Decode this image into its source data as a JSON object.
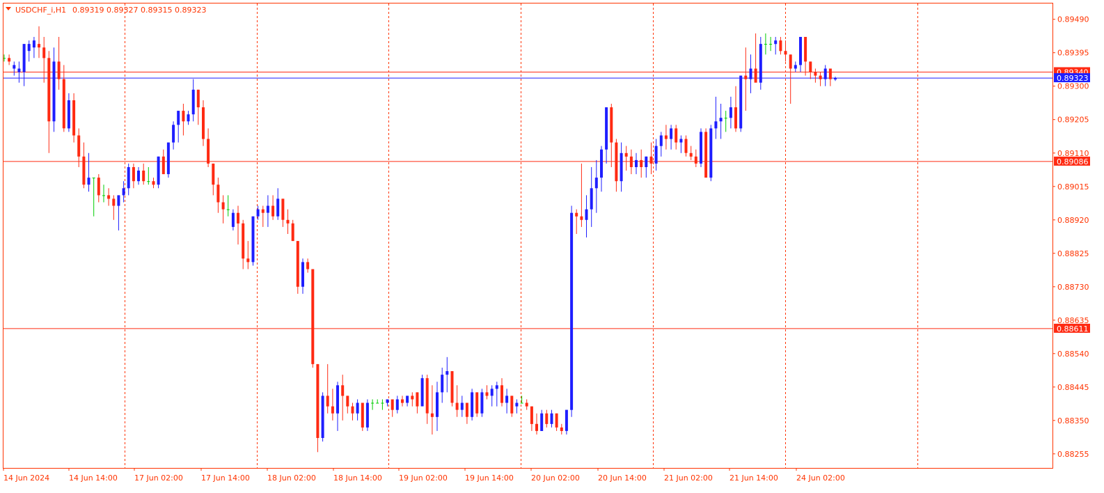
{
  "header": {
    "symbol": "USDCHF_i,H1",
    "ohlc": "0.89319 0.89327 0.89315 0.89323"
  },
  "colors": {
    "bull": "#1e1eff",
    "bear": "#ff2a12",
    "doji": "#00cc00",
    "grid": "#ff3300",
    "text": "#ff3300",
    "level": "#ff2a12",
    "bid_line": "#1e1eff",
    "frame": "#ff3300"
  },
  "chart_data": {
    "type": "candlestick",
    "symbol": "USDCHF_i",
    "timeframe": "H1",
    "ylim": [
      0.88215,
      0.89535
    ],
    "y_ticks": [
      "0.89490",
      "0.89395",
      "0.89300",
      "0.89205",
      "0.89110",
      "0.89015",
      "0.88920",
      "0.88825",
      "0.88730",
      "0.88635",
      "0.88540",
      "0.88445",
      "0.88350",
      "0.88255"
    ],
    "x_labels": [
      "14 Jun 2024",
      "14 Jun 14:00",
      "17 Jun 02:00",
      "17 Jun 14:00",
      "18 Jun 02:00",
      "18 Jun 14:00",
      "19 Jun 02:00",
      "19 Jun 14:00",
      "20 Jun 02:00",
      "20 Jun 14:00",
      "21 Jun 02:00",
      "21 Jun 14:00",
      "24 Jun 02:00"
    ],
    "grid": "vertical dotted",
    "price_levels": [
      {
        "label": "0.89340",
        "value": 0.8934,
        "role": "horizontal line"
      },
      {
        "label": "0.89323",
        "value": 0.89323,
        "role": "bid line"
      },
      {
        "label": "0.89086",
        "value": 0.89086,
        "role": "horizontal line"
      },
      {
        "label": "0.88611",
        "value": 0.88611,
        "role": "horizontal line"
      }
    ],
    "candles": [
      [
        0.8938,
        0.8939,
        0.8937,
        0.8938
      ],
      [
        0.8938,
        0.8939,
        0.8936,
        0.8937
      ],
      [
        0.8935,
        0.8937,
        0.8933,
        0.8936
      ],
      [
        0.8934,
        0.8937,
        0.8931,
        0.8935
      ],
      [
        0.8934,
        0.8939,
        0.893,
        0.8942
      ],
      [
        0.894,
        0.8943,
        0.8937,
        0.8942
      ],
      [
        0.8941,
        0.8944,
        0.8938,
        0.8943
      ],
      [
        0.8942,
        0.8947,
        0.8938,
        0.8941
      ],
      [
        0.8941,
        0.8944,
        0.8931,
        0.8938
      ],
      [
        0.8938,
        0.894,
        0.8911,
        0.892
      ],
      [
        0.892,
        0.8941,
        0.8917,
        0.8937
      ],
      [
        0.8937,
        0.8944,
        0.8929,
        0.8932
      ],
      [
        0.8932,
        0.8936,
        0.8917,
        0.8918
      ],
      [
        0.8918,
        0.8928,
        0.8917,
        0.8926
      ],
      [
        0.8926,
        0.8928,
        0.8914,
        0.8916
      ],
      [
        0.8916,
        0.8918,
        0.8907,
        0.891
      ],
      [
        0.891,
        0.8914,
        0.8901,
        0.8902
      ],
      [
        0.8902,
        0.8911,
        0.89,
        0.8904
      ],
      [
        0.8904,
        0.8904,
        0.8893,
        0.8904
      ],
      [
        0.8904,
        0.8905,
        0.8897,
        0.8899
      ],
      [
        0.8899,
        0.8902,
        0.8897,
        0.8899
      ],
      [
        0.8899,
        0.8901,
        0.8896,
        0.8898
      ],
      [
        0.8898,
        0.8899,
        0.8892,
        0.8896
      ],
      [
        0.8896,
        0.8899,
        0.8889,
        0.8899
      ],
      [
        0.8899,
        0.8903,
        0.8897,
        0.8901
      ],
      [
        0.8901,
        0.8908,
        0.8899,
        0.8907
      ],
      [
        0.8907,
        0.8908,
        0.8901,
        0.8903
      ],
      [
        0.8903,
        0.8907,
        0.8902,
        0.8906
      ],
      [
        0.8906,
        0.8908,
        0.8902,
        0.8903
      ],
      [
        0.8903,
        0.8907,
        0.8902,
        0.8903
      ],
      [
        0.8903,
        0.8904,
        0.8901,
        0.8902
      ],
      [
        0.8902,
        0.891,
        0.8901,
        0.891
      ],
      [
        0.891,
        0.8912,
        0.8905,
        0.8905
      ],
      [
        0.8905,
        0.8914,
        0.8904,
        0.8914
      ],
      [
        0.8914,
        0.892,
        0.8912,
        0.8919
      ],
      [
        0.8919,
        0.8923,
        0.8914,
        0.8923
      ],
      [
        0.8923,
        0.8925,
        0.8916,
        0.892
      ],
      [
        0.892,
        0.8923,
        0.8919,
        0.8922
      ],
      [
        0.8922,
        0.8932,
        0.892,
        0.8929
      ],
      [
        0.8929,
        0.8929,
        0.8919,
        0.8924
      ],
      [
        0.8924,
        0.8926,
        0.8913,
        0.8915
      ],
      [
        0.8915,
        0.8918,
        0.8907,
        0.8908
      ],
      [
        0.8908,
        0.8908,
        0.8899,
        0.8902
      ],
      [
        0.8902,
        0.8904,
        0.8894,
        0.8897
      ],
      [
        0.8897,
        0.8899,
        0.8891,
        0.8895
      ],
      [
        0.8895,
        0.8899,
        0.8893,
        0.8895
      ],
      [
        0.889,
        0.8895,
        0.8889,
        0.8894
      ],
      [
        0.8894,
        0.8896,
        0.8885,
        0.8891
      ],
      [
        0.8891,
        0.8892,
        0.8878,
        0.8881
      ],
      [
        0.8881,
        0.8886,
        0.8878,
        0.888
      ],
      [
        0.888,
        0.8893,
        0.8879,
        0.8893
      ],
      [
        0.8893,
        0.8896,
        0.8892,
        0.8895
      ],
      [
        0.8895,
        0.8896,
        0.889,
        0.8894
      ],
      [
        0.8894,
        0.8899,
        0.889,
        0.8896
      ],
      [
        0.8896,
        0.8899,
        0.8892,
        0.8893
      ],
      [
        0.8893,
        0.8901,
        0.8892,
        0.8898
      ],
      [
        0.8898,
        0.8898,
        0.889,
        0.8892
      ],
      [
        0.8892,
        0.8895,
        0.8888,
        0.8891
      ],
      [
        0.8891,
        0.8892,
        0.8886,
        0.8886
      ],
      [
        0.8886,
        0.8886,
        0.8871,
        0.8873
      ],
      [
        0.8873,
        0.8881,
        0.8871,
        0.888
      ],
      [
        0.888,
        0.8881,
        0.8877,
        0.8878
      ],
      [
        0.8878,
        0.8878,
        0.885,
        0.8851
      ],
      [
        0.8851,
        0.8851,
        0.8826,
        0.883
      ],
      [
        0.883,
        0.8843,
        0.8829,
        0.8842
      ],
      [
        0.8842,
        0.8851,
        0.8837,
        0.8839
      ],
      [
        0.8839,
        0.8844,
        0.8835,
        0.8837
      ],
      [
        0.8837,
        0.8846,
        0.8832,
        0.8845
      ],
      [
        0.8845,
        0.8848,
        0.8835,
        0.8842
      ],
      [
        0.8842,
        0.8842,
        0.8837,
        0.8839
      ],
      [
        0.8839,
        0.884,
        0.8835,
        0.8837
      ],
      [
        0.8837,
        0.8841,
        0.8835,
        0.884
      ],
      [
        0.884,
        0.884,
        0.8832,
        0.8833
      ],
      [
        0.8833,
        0.8841,
        0.8832,
        0.884
      ],
      [
        0.884,
        0.8841,
        0.8838,
        0.884
      ],
      [
        0.884,
        0.8841,
        0.884,
        0.884
      ],
      [
        0.884,
        0.8841,
        0.8838,
        0.884
      ],
      [
        0.884,
        0.8841,
        0.8839,
        0.8841
      ],
      [
        0.8841,
        0.8841,
        0.8836,
        0.8838
      ],
      [
        0.8838,
        0.8842,
        0.8837,
        0.8841
      ],
      [
        0.8841,
        0.8842,
        0.8839,
        0.884
      ],
      [
        0.884,
        0.8842,
        0.8839,
        0.8842
      ],
      [
        0.8842,
        0.8843,
        0.8839,
        0.8841
      ],
      [
        0.8843,
        0.8843,
        0.8837,
        0.8839
      ],
      [
        0.8839,
        0.8848,
        0.8839,
        0.8847
      ],
      [
        0.8847,
        0.8848,
        0.8834,
        0.8837
      ],
      [
        0.8837,
        0.8845,
        0.8831,
        0.8836
      ],
      [
        0.8836,
        0.8846,
        0.8832,
        0.8843
      ],
      [
        0.8843,
        0.885,
        0.884,
        0.8848
      ],
      [
        0.8848,
        0.8853,
        0.8843,
        0.8849
      ],
      [
        0.8849,
        0.8849,
        0.8839,
        0.884
      ],
      [
        0.884,
        0.8845,
        0.8836,
        0.8838
      ],
      [
        0.8838,
        0.8842,
        0.8836,
        0.884
      ],
      [
        0.884,
        0.884,
        0.8834,
        0.8836
      ],
      [
        0.8836,
        0.8844,
        0.8835,
        0.8843
      ],
      [
        0.8843,
        0.8843,
        0.8836,
        0.8837
      ],
      [
        0.8837,
        0.8844,
        0.8836,
        0.8843
      ],
      [
        0.8843,
        0.8845,
        0.8841,
        0.8842
      ],
      [
        0.8842,
        0.8845,
        0.8839,
        0.8844
      ],
      [
        0.8844,
        0.8846,
        0.8839,
        0.8845
      ],
      [
        0.8845,
        0.8847,
        0.8839,
        0.884
      ],
      [
        0.884,
        0.8844,
        0.8837,
        0.8842
      ],
      [
        0.8842,
        0.8842,
        0.8836,
        0.8837
      ],
      [
        0.8839,
        0.8841,
        0.8837,
        0.884
      ],
      [
        0.884,
        0.8842,
        0.884,
        0.884
      ],
      [
        0.884,
        0.8841,
        0.8838,
        0.8839
      ],
      [
        0.8839,
        0.8839,
        0.8832,
        0.8834
      ],
      [
        0.8834,
        0.8837,
        0.8831,
        0.8832
      ],
      [
        0.8832,
        0.8838,
        0.8832,
        0.8837
      ],
      [
        0.8837,
        0.8838,
        0.8833,
        0.8834
      ],
      [
        0.8834,
        0.8838,
        0.8833,
        0.8837
      ],
      [
        0.8837,
        0.8837,
        0.8832,
        0.8833
      ],
      [
        0.8833,
        0.8834,
        0.8831,
        0.8832
      ],
      [
        0.8832,
        0.8838,
        0.8831,
        0.8838
      ],
      [
        0.8838,
        0.8896,
        0.8836,
        0.8894
      ],
      [
        0.8894,
        0.8895,
        0.8888,
        0.8893
      ],
      [
        0.8893,
        0.8908,
        0.889,
        0.8892
      ],
      [
        0.8892,
        0.8899,
        0.8887,
        0.8895
      ],
      [
        0.8895,
        0.8907,
        0.889,
        0.8901
      ],
      [
        0.8901,
        0.8909,
        0.8894,
        0.8904
      ],
      [
        0.8904,
        0.8913,
        0.89,
        0.8912
      ],
      [
        0.8912,
        0.8924,
        0.8908,
        0.8924
      ],
      [
        0.8924,
        0.8925,
        0.8907,
        0.8914
      ],
      [
        0.8914,
        0.8915,
        0.89,
        0.8903
      ],
      [
        0.8903,
        0.8914,
        0.89,
        0.8911
      ],
      [
        0.8911,
        0.8913,
        0.8906,
        0.891
      ],
      [
        0.891,
        0.8912,
        0.8905,
        0.8907
      ],
      [
        0.8907,
        0.8911,
        0.8905,
        0.8909
      ],
      [
        0.8909,
        0.8912,
        0.8904,
        0.8907
      ],
      [
        0.8907,
        0.891,
        0.8904,
        0.891
      ],
      [
        0.891,
        0.8914,
        0.8905,
        0.8908
      ],
      [
        0.8908,
        0.8915,
        0.8906,
        0.8913
      ],
      [
        0.8913,
        0.8917,
        0.891,
        0.8916
      ],
      [
        0.8916,
        0.8919,
        0.8912,
        0.8915
      ],
      [
        0.8915,
        0.8919,
        0.8912,
        0.8918
      ],
      [
        0.8918,
        0.8919,
        0.8912,
        0.8914
      ],
      [
        0.8914,
        0.8916,
        0.8911,
        0.8915
      ],
      [
        0.8915,
        0.8916,
        0.891,
        0.8911
      ],
      [
        0.8911,
        0.8913,
        0.8909,
        0.891
      ],
      [
        0.891,
        0.8912,
        0.8907,
        0.8908
      ],
      [
        0.8908,
        0.8918,
        0.8907,
        0.8917
      ],
      [
        0.8917,
        0.8918,
        0.8905,
        0.8904
      ],
      [
        0.8904,
        0.8919,
        0.8903,
        0.8918
      ],
      [
        0.8918,
        0.8927,
        0.8915,
        0.892
      ],
      [
        0.892,
        0.8925,
        0.8915,
        0.8921
      ],
      [
        0.8921,
        0.8923,
        0.8917,
        0.8921
      ],
      [
        0.8921,
        0.8927,
        0.8918,
        0.8924
      ],
      [
        0.8924,
        0.893,
        0.8917,
        0.8918
      ],
      [
        0.8918,
        0.8933,
        0.8917,
        0.8933
      ],
      [
        0.8933,
        0.8941,
        0.8923,
        0.8932
      ],
      [
        0.8932,
        0.8939,
        0.8928,
        0.8935
      ],
      [
        0.8935,
        0.8945,
        0.8932,
        0.8931
      ],
      [
        0.8931,
        0.8944,
        0.8929,
        0.8942
      ],
      [
        0.8942,
        0.8945,
        0.8939,
        0.8942
      ],
      [
        0.8942,
        0.8944,
        0.894,
        0.8942
      ],
      [
        0.8942,
        0.8944,
        0.8939,
        0.8943
      ],
      [
        0.8943,
        0.8944,
        0.8939,
        0.894
      ],
      [
        0.894,
        0.8943,
        0.8937,
        0.8939
      ],
      [
        0.8939,
        0.8939,
        0.8925,
        0.8935
      ],
      [
        0.8935,
        0.8937,
        0.8934,
        0.8936
      ],
      [
        0.8936,
        0.8944,
        0.8934,
        0.8944
      ],
      [
        0.8944,
        0.8944,
        0.8933,
        0.8937
      ],
      [
        0.8937,
        0.8937,
        0.8932,
        0.8934
      ],
      [
        0.8934,
        0.8935,
        0.8931,
        0.8933
      ],
      [
        0.8933,
        0.8934,
        0.893,
        0.8932
      ],
      [
        0.8932,
        0.8936,
        0.893,
        0.8935
      ],
      [
        0.8935,
        0.8935,
        0.893,
        0.8932
      ],
      [
        0.89319,
        0.89327,
        0.89315,
        0.89323
      ]
    ]
  }
}
